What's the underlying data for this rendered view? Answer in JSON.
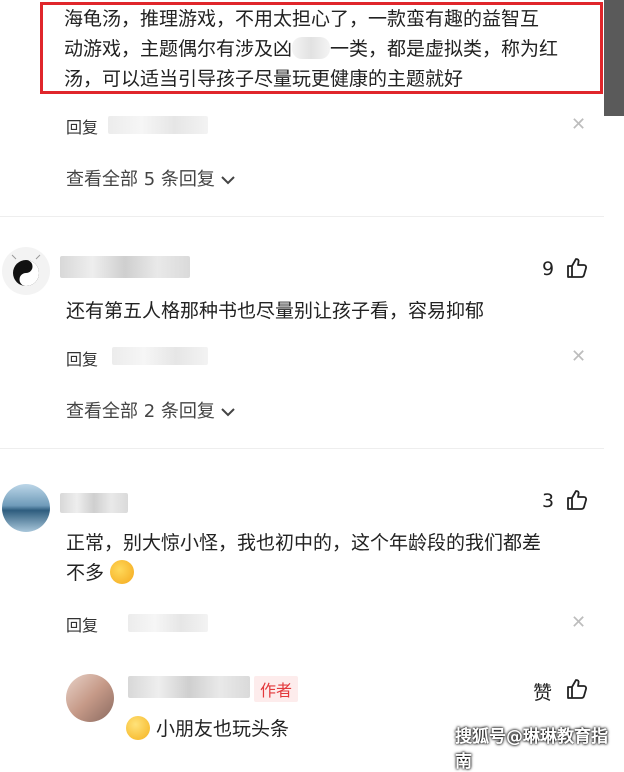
{
  "top_comment": {
    "lines": [
      "海龟汤，推理游戏，不用太担心了，一款蛮有趣的益智互",
      "动游戏，主题偶尔有涉及凶",
      "一类，都是虚拟类，称为红",
      "汤，可以适当引导孩子尽量玩更健康的主题就好"
    ],
    "reply_label": "回复",
    "view_all_label": "查看全部 5 条回复"
  },
  "comment2": {
    "text": "还有第五人格那种书也尽量别让孩子看，容易抑郁",
    "likes": "9",
    "reply_label": "回复",
    "view_all_label": "查看全部 2 条回复"
  },
  "comment3": {
    "line1": "正常，别大惊小怪，我也初中的，这个年龄段的我们都差",
    "line2": "不多",
    "likes": "3",
    "reply_label": "回复"
  },
  "author_reply": {
    "author_tag": "作者",
    "like_label": "赞",
    "text": "小朋友也玩头条"
  },
  "watermark": "搜狐号@琳琳教育指南",
  "colors": {
    "highlight_border": "#e0262b",
    "author_tag": "#e3393c"
  },
  "icons": [
    "thumb-up-icon",
    "close-icon",
    "chevron-down-icon",
    "avatar",
    "emoji"
  ]
}
